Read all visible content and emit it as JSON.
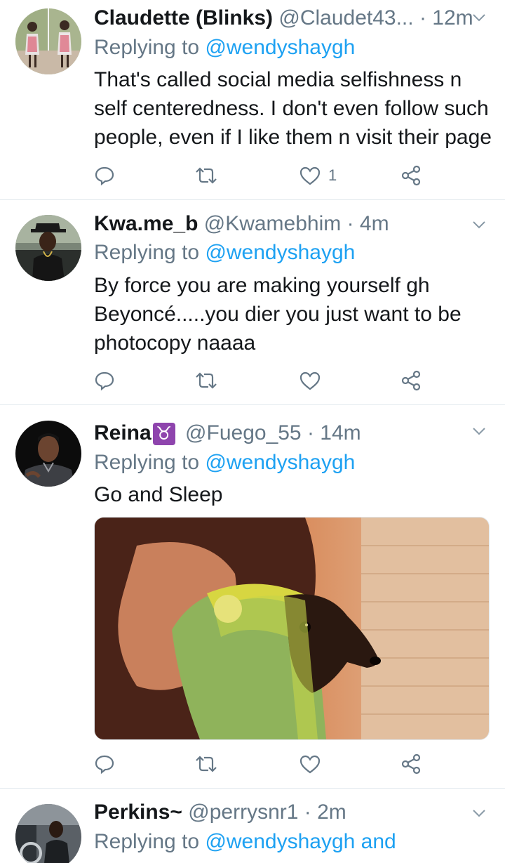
{
  "tweets": [
    {
      "name": "Claudette (Blinks)",
      "handle": "@Claudet43...",
      "time": "· 12m",
      "replying_label": "Replying to",
      "replying_to": "@wendyshaygh",
      "text_lines": [
        "That's called social media selfishness n",
        "self centeredness. I don't even follow such",
        "people, even if I like them n visit their page"
      ],
      "like_count": "1"
    },
    {
      "name": "Kwa.me_b",
      "handle": "@Kwamebhim",
      "time": "· 4m",
      "replying_label": "Replying to",
      "replying_to": "@wendyshaygh",
      "text_lines": [
        "By force you are making yourself gh",
        "Beyoncé.....you dier you just want to be",
        "photocopy naaaa"
      ],
      "like_count": ""
    },
    {
      "name": "Reina",
      "name_emoji": "♉",
      "handle": "@Fuego_55",
      "time": "· 14m",
      "replying_label": "Replying to",
      "replying_to": "@wendyshaygh",
      "text_lines": [
        "Go and Sleep"
      ],
      "like_count": ""
    },
    {
      "name": "Perkins~",
      "handle": "@perrysnr1",
      "time": "· 2m",
      "replying_label": "Replying to",
      "replying_to": "@wendyshaygh and"
    }
  ],
  "colors": {
    "text": "#14171a",
    "muted": "#657786",
    "link": "#1da1f2",
    "divider": "#e1e8ed",
    "taurus_badge": "#8e44ad"
  },
  "icons": {
    "reply": "reply-icon",
    "retweet": "retweet-icon",
    "like": "heart-icon",
    "share": "share-icon",
    "more": "chevron-down-icon"
  }
}
